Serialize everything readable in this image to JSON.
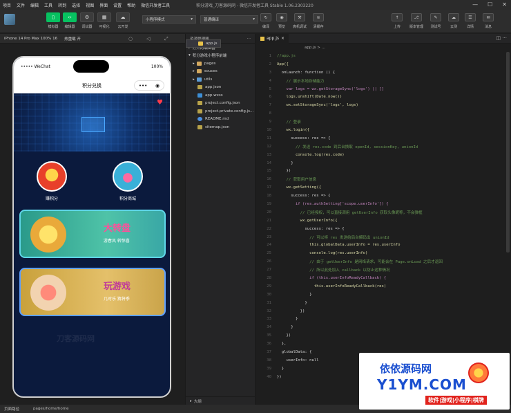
{
  "menu": [
    "项目",
    "文件",
    "编辑",
    "工具",
    "转到",
    "选择",
    "视图",
    "界面",
    "设置",
    "帮助",
    "微信开发者工具"
  ],
  "window_title": "积分游戏_刀客源码网 - 微信开发者工具 Stable 1.06.2303220",
  "toolbar": {
    "left_buttons": [
      "模拟器",
      "编辑器",
      "调试器",
      "可视化",
      "云开发"
    ],
    "mode_select": "小程序模式",
    "compile_select": "普通编译",
    "mid_buttons": [
      "编译",
      "预览",
      "真机调试",
      "清缓存"
    ],
    "right_buttons": [
      "上传",
      "版本管理",
      "测试号",
      "云测",
      "详情",
      "消息"
    ]
  },
  "simulator": {
    "device": "iPhone 14 Pro Max 100% 16",
    "hotreload": "热重载 开",
    "carrier": "••••• WeChat",
    "battery": "100%",
    "nav_title": "积分兑换",
    "capsule_more": "•••",
    "circles": [
      {
        "label": "赚积分"
      },
      {
        "label": "积分商城"
      }
    ],
    "cards": [
      {
        "title": "大转盘",
        "sub": "游春风  转惊喜"
      },
      {
        "title": "玩游戏",
        "sub": "几时乐  猜将季"
      }
    ],
    "watermark": "刀客源码网"
  },
  "explorer": {
    "header": "资源管理器",
    "sections": [
      "打开的编辑器",
      "积分游戏小程序前端"
    ],
    "items": [
      {
        "name": "pages",
        "type": "folder"
      },
      {
        "name": "souces",
        "type": "folder"
      },
      {
        "name": "utils",
        "type": "folder"
      },
      {
        "name": "app.js",
        "type": "js",
        "selected": true
      },
      {
        "name": "app.json",
        "type": "json"
      },
      {
        "name": "app.wxss",
        "type": "wxss"
      },
      {
        "name": "project.config.json",
        "type": "json"
      },
      {
        "name": "project.private.config.js...",
        "type": "json"
      },
      {
        "name": "README.md",
        "type": "info"
      },
      {
        "name": "sitemap.json",
        "type": "json"
      }
    ],
    "outline": "大纲"
  },
  "editor": {
    "tab": "app.js",
    "breadcrumb": "app.js > ...",
    "lines": [
      "//app.js",
      "App({",
      "  onLaunch: function () {",
      "    // 展示本地存储能力",
      "    var logs = wx.getStorageSync('logs') || []",
      "    logs.unshift(Date.now())",
      "    wx.setStorageSync('logs', logs)",
      "",
      "    // 登录",
      "    wx.login({",
      "      success: res => {",
      "        // 发送 res.code 到后台换取 openId, sessionKey, unionId",
      "        console.log(res.code)",
      "      }",
      "    })",
      "    // 获取用户信息",
      "    wx.getSetting({",
      "      success: res => {",
      "        if (res.authSetting['scope.userInfo']) {",
      "          // 已经授权，可以直接调用 getUserInfo 获取头像昵称，不会弹框",
      "          wx.getUserInfo({",
      "            success: res => {",
      "              // 可以将 res 发送给后台解码出 unionId",
      "              this.globalData.userInfo = res.userInfo",
      "              console.log(res.userInfo)",
      "              // 由于 getUserInfo 是网络请求，可能会在 Page.onLoad 之后才返回",
      "              // 所以此处加入 callback 以防止这种情况",
      "              if (this.userInfoReadyCallback) {",
      "                this.userInfoReadyCallback(res)",
      "              }",
      "            }",
      "          })",
      "        }",
      "      }",
      "    })",
      "  },",
      "  globalData: {",
      "    userInfo: null",
      "  }",
      "})"
    ]
  },
  "statusbar": {
    "path_label": "页面路径",
    "path": "pages/home/home"
  },
  "watermark": {
    "line1": "依依源码网",
    "line2": "Y1YM.COM",
    "line3": "软件|游戏|小程序|棋牌"
  }
}
